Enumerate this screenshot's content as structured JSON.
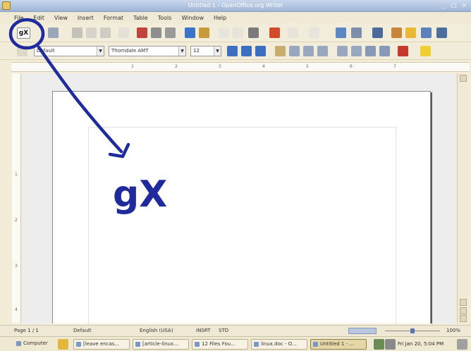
{
  "window": {
    "title": "Untitled 1 - OpenOffice.org Writer",
    "controls": [
      "_",
      "□",
      "×"
    ]
  },
  "menubar": {
    "items": [
      "File",
      "Edit",
      "View",
      "Insert",
      "Format",
      "Table",
      "Tools",
      "Window",
      "Help"
    ]
  },
  "toolbar": {
    "gx_button_label": "gX"
  },
  "formatting": {
    "style_value": "Default",
    "font_name_value": "Thorndale AMT",
    "font_size_value": "12"
  },
  "ruler": {
    "numbers": [
      "1",
      "2",
      "3",
      "4",
      "5",
      "6",
      "7"
    ]
  },
  "vertical_ruler": {
    "numbers": [
      "1",
      "2",
      "3",
      "4"
    ]
  },
  "annotation": {
    "handwritten_label": "gX"
  },
  "statusbar": {
    "page": "Page 1 / 1",
    "style": "Default",
    "language": "English (USA)",
    "insert_mode": "INSRT",
    "selection_mode": "STD",
    "zoom": "100%"
  },
  "taskbar": {
    "start_label": "Computer",
    "tasks": [
      {
        "label": "[leave encas..."
      },
      {
        "label": "[article-linux..."
      },
      {
        "label": "12 Files Fou..."
      },
      {
        "label": "linux.doc - O..."
      },
      {
        "label": "Untitled 1 - ..."
      }
    ],
    "clock": "Fri Jan 20, 5:04 PM"
  },
  "colors": {
    "annotation_ink": "#1f2a9c",
    "title_bar": "#9fb5d6",
    "background": "#f3ecd9"
  }
}
